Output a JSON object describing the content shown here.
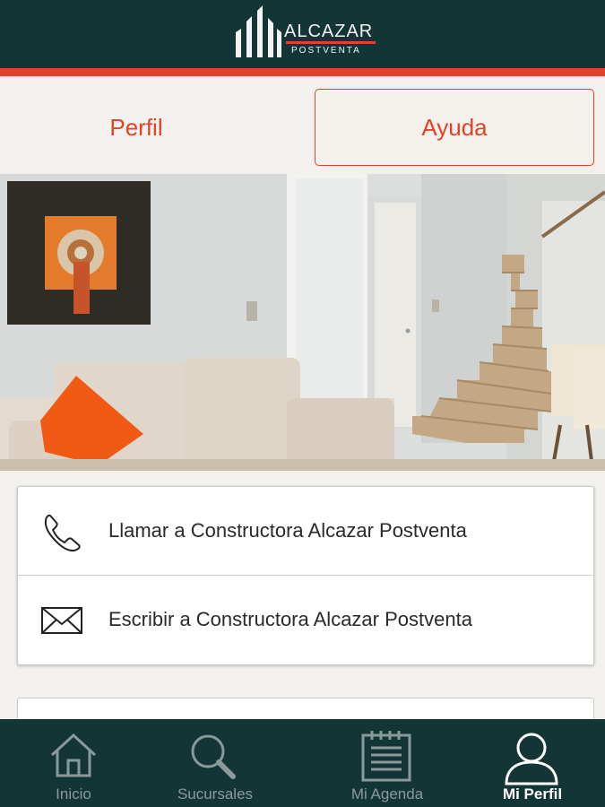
{
  "header": {
    "logo_title": "ALCAZAR",
    "logo_subtitle": "POSTVENTA"
  },
  "tabs": [
    {
      "label": "Perfil"
    },
    {
      "label": "Ayuda"
    }
  ],
  "actions": [
    {
      "label": "Llamar a Constructora Alcazar Postventa",
      "icon": "phone-icon"
    },
    {
      "label": "Escribir a Constructora Alcazar Postventa",
      "icon": "mail-icon"
    }
  ],
  "bottom_nav": [
    {
      "label": "Inicio",
      "icon": "home-icon"
    },
    {
      "label": "Sucursales",
      "icon": "search-icon"
    },
    {
      "label": "Mi Agenda",
      "icon": "agenda-icon"
    },
    {
      "label": "Mi Perfil",
      "icon": "user-icon",
      "active": true
    }
  ],
  "colors": {
    "header_bg": "#143535",
    "accent": "#e0432a",
    "page_bg": "#f3f1ee"
  }
}
